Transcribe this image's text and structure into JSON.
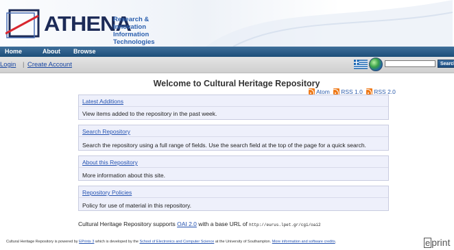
{
  "header": {
    "logo_word": "ATHENA",
    "logo_sub_line1": "Research & Innovation",
    "logo_sub_line2": "Information Technologies"
  },
  "nav": {
    "items": [
      {
        "label": "Home"
      },
      {
        "label": "About"
      },
      {
        "label": "Browse"
      }
    ]
  },
  "account": {
    "login": "Login",
    "separator": "|",
    "create": "Create Account"
  },
  "search": {
    "value": "",
    "button": "Search"
  },
  "page": {
    "title": "Welcome to Cultural Heritage Repository"
  },
  "feeds": [
    {
      "label": "Atom"
    },
    {
      "label": "RSS 1.0"
    },
    {
      "label": "RSS 2.0"
    }
  ],
  "boxes": [
    {
      "title": "Latest Additions",
      "desc": "View items added to the repository in the past week."
    },
    {
      "title": "Search Repository",
      "desc": "Search the repository using a full range of fields. Use the search field at the top of the page for a quick search."
    },
    {
      "title": "About this Repository",
      "desc": "More information about this site."
    },
    {
      "title": "Repository Policies",
      "desc": "Policy for use of material in this repository."
    }
  ],
  "oai": {
    "before": "Cultural Heritage Repository supports ",
    "link": "OAI 2.0",
    "middle": " with a base URL of ",
    "url": "http://eurus.lpet.gr/cgi/oai2"
  },
  "footer": {
    "t1": "Cultural Heritage Repository is powered by ",
    "l1": "EPrints 3",
    "t2": " which is developed by the ",
    "l2": "School of Electronics and Computer Science",
    "t3": " at the University of Southampton. ",
    "l3": "More information and software credits",
    "t4": ".",
    "logo_e": "e",
    "logo_rest": "print"
  },
  "colors": {
    "nav_bar": "#1d4e79",
    "link": "#2452b0",
    "box_bg": "#eef0fb",
    "rss": "#ef7a19"
  }
}
